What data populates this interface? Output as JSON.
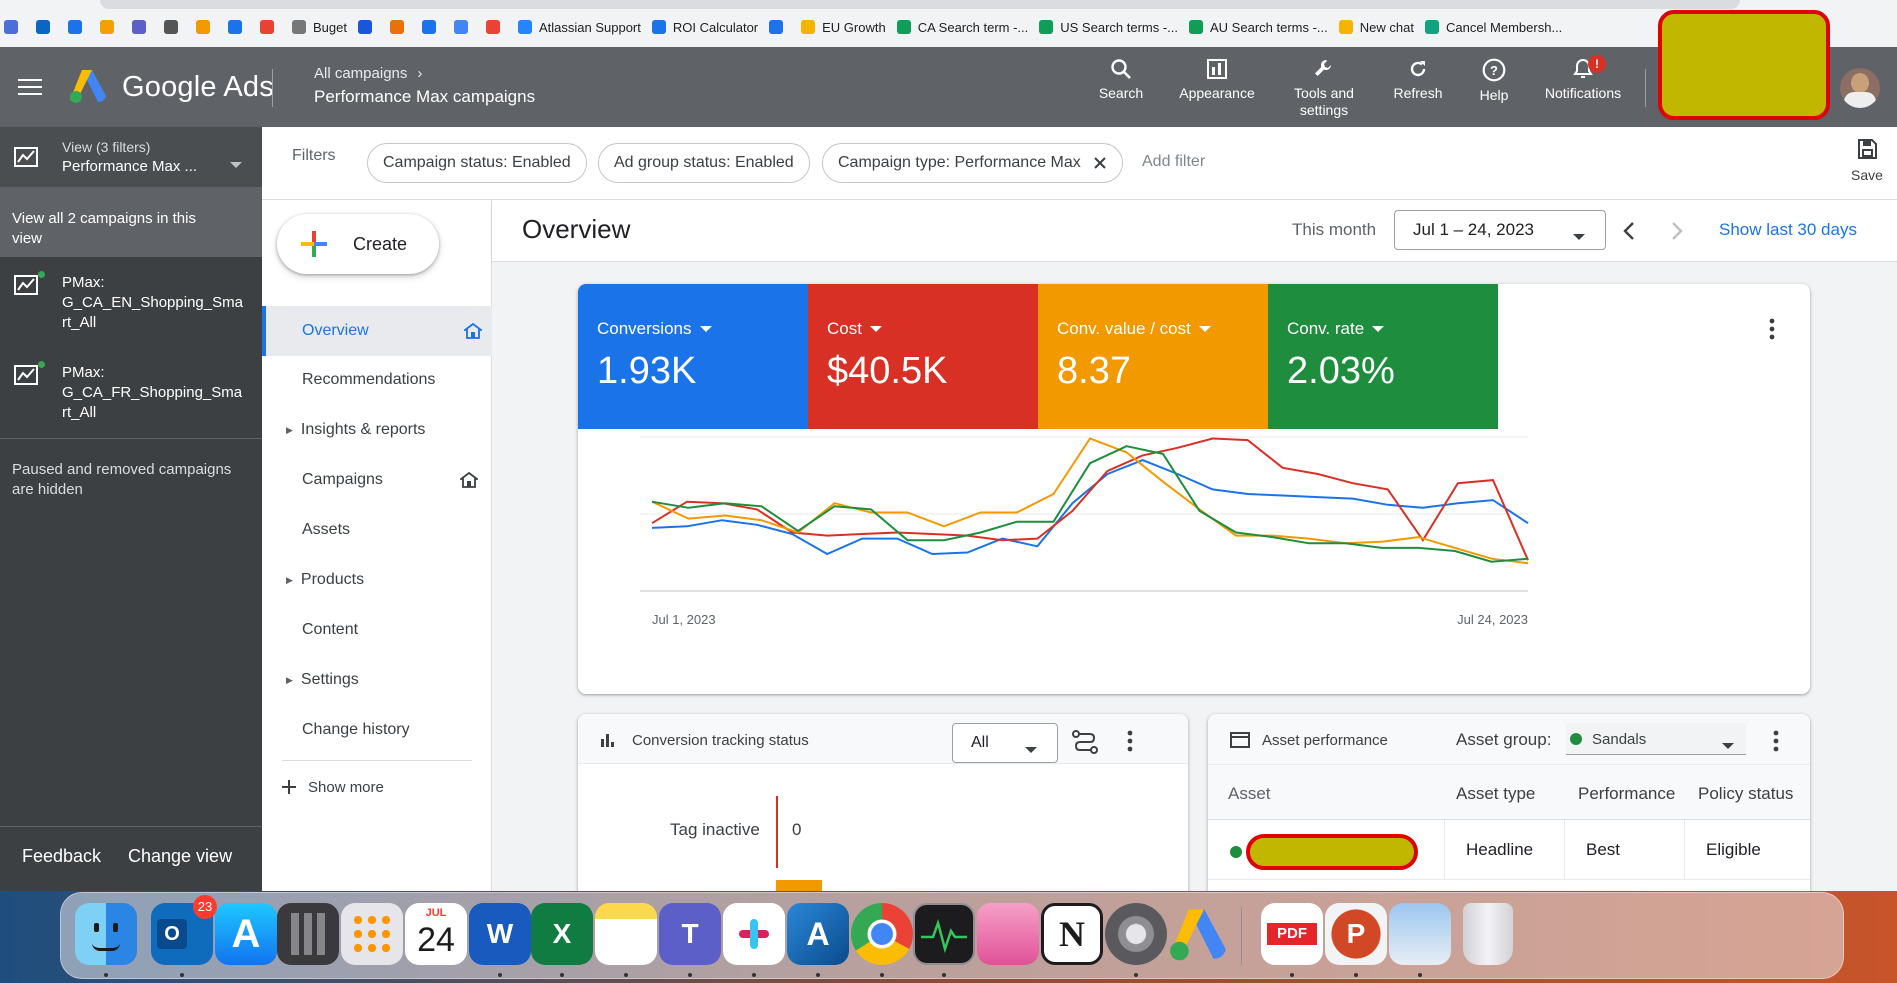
{
  "bookmarks": [
    {
      "label": "",
      "color": "#4a6fd8"
    },
    {
      "label": "",
      "color": "#0a66c2"
    },
    {
      "label": "",
      "color": "#1a73e8"
    },
    {
      "label": "",
      "color": "#f4a100"
    },
    {
      "label": "",
      "color": "#5b5fc7"
    },
    {
      "label": "",
      "color": "#555555"
    },
    {
      "label": "",
      "color": "#f29900"
    },
    {
      "label": "",
      "color": "#1a73e8"
    },
    {
      "label": "",
      "color": "#e94235"
    },
    {
      "label": "Buget",
      "color": "#777777"
    },
    {
      "label": "",
      "color": "#1a56db"
    },
    {
      "label": "",
      "color": "#e8710a"
    },
    {
      "label": "",
      "color": "#1a73e8"
    },
    {
      "label": "",
      "color": "#4285f4"
    },
    {
      "label": "",
      "color": "#ea4335"
    },
    {
      "label": "Atlassian Support",
      "color": "#2684ff"
    },
    {
      "label": "ROI Calculator",
      "color": "#1a73e8"
    },
    {
      "label": "",
      "color": "#1a73e8"
    },
    {
      "label": "EU Growth",
      "color": "#f4b400"
    },
    {
      "label": "CA Search term -...",
      "color": "#0f9d58"
    },
    {
      "label": "US Search terms -...",
      "color": "#0f9d58"
    },
    {
      "label": "AU Search terms -...",
      "color": "#0f9d58"
    },
    {
      "label": "New chat",
      "color": "#f4b400"
    },
    {
      "label": "Cancel Membersh...",
      "color": "#10a37f"
    }
  ],
  "header": {
    "brand": "Google Ads",
    "crumb_parent": "All campaigns",
    "crumb_current": "Performance Max campaigns",
    "buttons": {
      "search": "Search",
      "appearance": "Appearance",
      "tools_line1": "Tools and",
      "tools_line2": "settings",
      "refresh": "Refresh",
      "help": "Help",
      "notifications": "Notifications"
    },
    "notification_badge": "!"
  },
  "left_panel": {
    "view_label": "View (3 filters)",
    "view_value": "Performance Max ...",
    "view_all_line1": "View all 2 campaigns in this",
    "view_all_line2": "view",
    "campaigns": [
      {
        "line1": "PMax:",
        "line2": "G_CA_EN_Shopping_Sma",
        "line3": "rt_All"
      },
      {
        "line1": "PMax:",
        "line2": "G_CA_FR_Shopping_Sma",
        "line3": "rt_All"
      }
    ],
    "hidden_line1": "Paused and removed campaigns",
    "hidden_line2": "are hidden",
    "feedback": "Feedback",
    "change_view": "Change view"
  },
  "filters": {
    "label": "Filters",
    "chips": [
      "Campaign status: Enabled",
      "Ad group status: Enabled",
      "Campaign type: Performance Max"
    ],
    "add_filter": "Add filter",
    "save": "Save"
  },
  "nav": {
    "create": "Create",
    "items": [
      "Overview",
      "Recommendations",
      "Insights & reports",
      "Campaigns",
      "Assets",
      "Products",
      "Content",
      "Settings",
      "Change history"
    ],
    "show_more": "Show more"
  },
  "overview": {
    "title": "Overview",
    "period_label": "This month",
    "date_range": "Jul 1 – 24, 2023",
    "show_last": "Show last 30 days"
  },
  "metrics": [
    {
      "label": "Conversions",
      "value": "1.93K",
      "color": "#1a73e8"
    },
    {
      "label": "Cost",
      "value": "$40.5K",
      "color": "#d93025"
    },
    {
      "label": "Conv. value / cost",
      "value": "8.37",
      "color": "#f29900"
    },
    {
      "label": "Conv. rate",
      "value": "2.03%",
      "color": "#1e8e3e"
    }
  ],
  "chart_data": {
    "type": "line",
    "x_start_label": "Jul 1, 2023",
    "x_end_label": "Jul 24, 2023",
    "x": [
      1,
      2,
      3,
      4,
      5,
      6,
      7,
      8,
      9,
      10,
      11,
      12,
      13,
      14,
      15,
      16,
      17,
      18,
      19,
      20,
      21,
      22,
      23,
      24
    ],
    "ylim": [
      0,
      100
    ],
    "grid": true,
    "series": [
      {
        "color": "#1a73e8",
        "values": [
          41,
          42,
          46,
          43,
          37,
          24,
          34,
          34,
          24,
          25,
          34,
          29,
          57,
          76,
          85,
          76,
          66,
          63,
          62,
          61,
          60,
          56,
          54,
          57,
          59,
          44
        ]
      },
      {
        "color": "#d93025",
        "values": [
          44,
          58,
          57,
          53,
          38,
          36,
          37,
          38,
          37,
          36,
          33,
          34,
          52,
          78,
          88,
          93,
          99,
          98,
          80,
          76,
          70,
          66,
          33,
          70,
          72,
          20
        ]
      },
      {
        "color": "#f29900",
        "values": [
          58,
          47,
          49,
          46,
          38,
          57,
          51,
          51,
          42,
          51,
          51,
          63,
          99,
          90,
          71,
          53,
          36,
          36,
          34,
          31,
          32,
          35,
          28,
          21,
          18
        ]
      },
      {
        "color": "#1e8e3e",
        "values": [
          58,
          54,
          57,
          55,
          39,
          55,
          53,
          33,
          33,
          38,
          45,
          45,
          83,
          94,
          89,
          52,
          38,
          35,
          31,
          31,
          28,
          28,
          26,
          19,
          21
        ]
      }
    ]
  },
  "conversion_tracking": {
    "title": "Conversion tracking status",
    "filter_value": "All",
    "row_label": "Tag inactive",
    "row_value": "0"
  },
  "asset_performance": {
    "title": "Asset performance",
    "group_label": "Asset group:",
    "group_value": "Sandals",
    "columns": [
      "Asset",
      "Asset type",
      "Performance",
      "Policy status"
    ],
    "row": {
      "type": "Headline",
      "performance": "Best",
      "policy": "Eligible"
    }
  },
  "dock": {
    "calendar_month": "JUL",
    "calendar_day": "24",
    "outlook_badge": "23",
    "pdf_label": "PDF"
  }
}
